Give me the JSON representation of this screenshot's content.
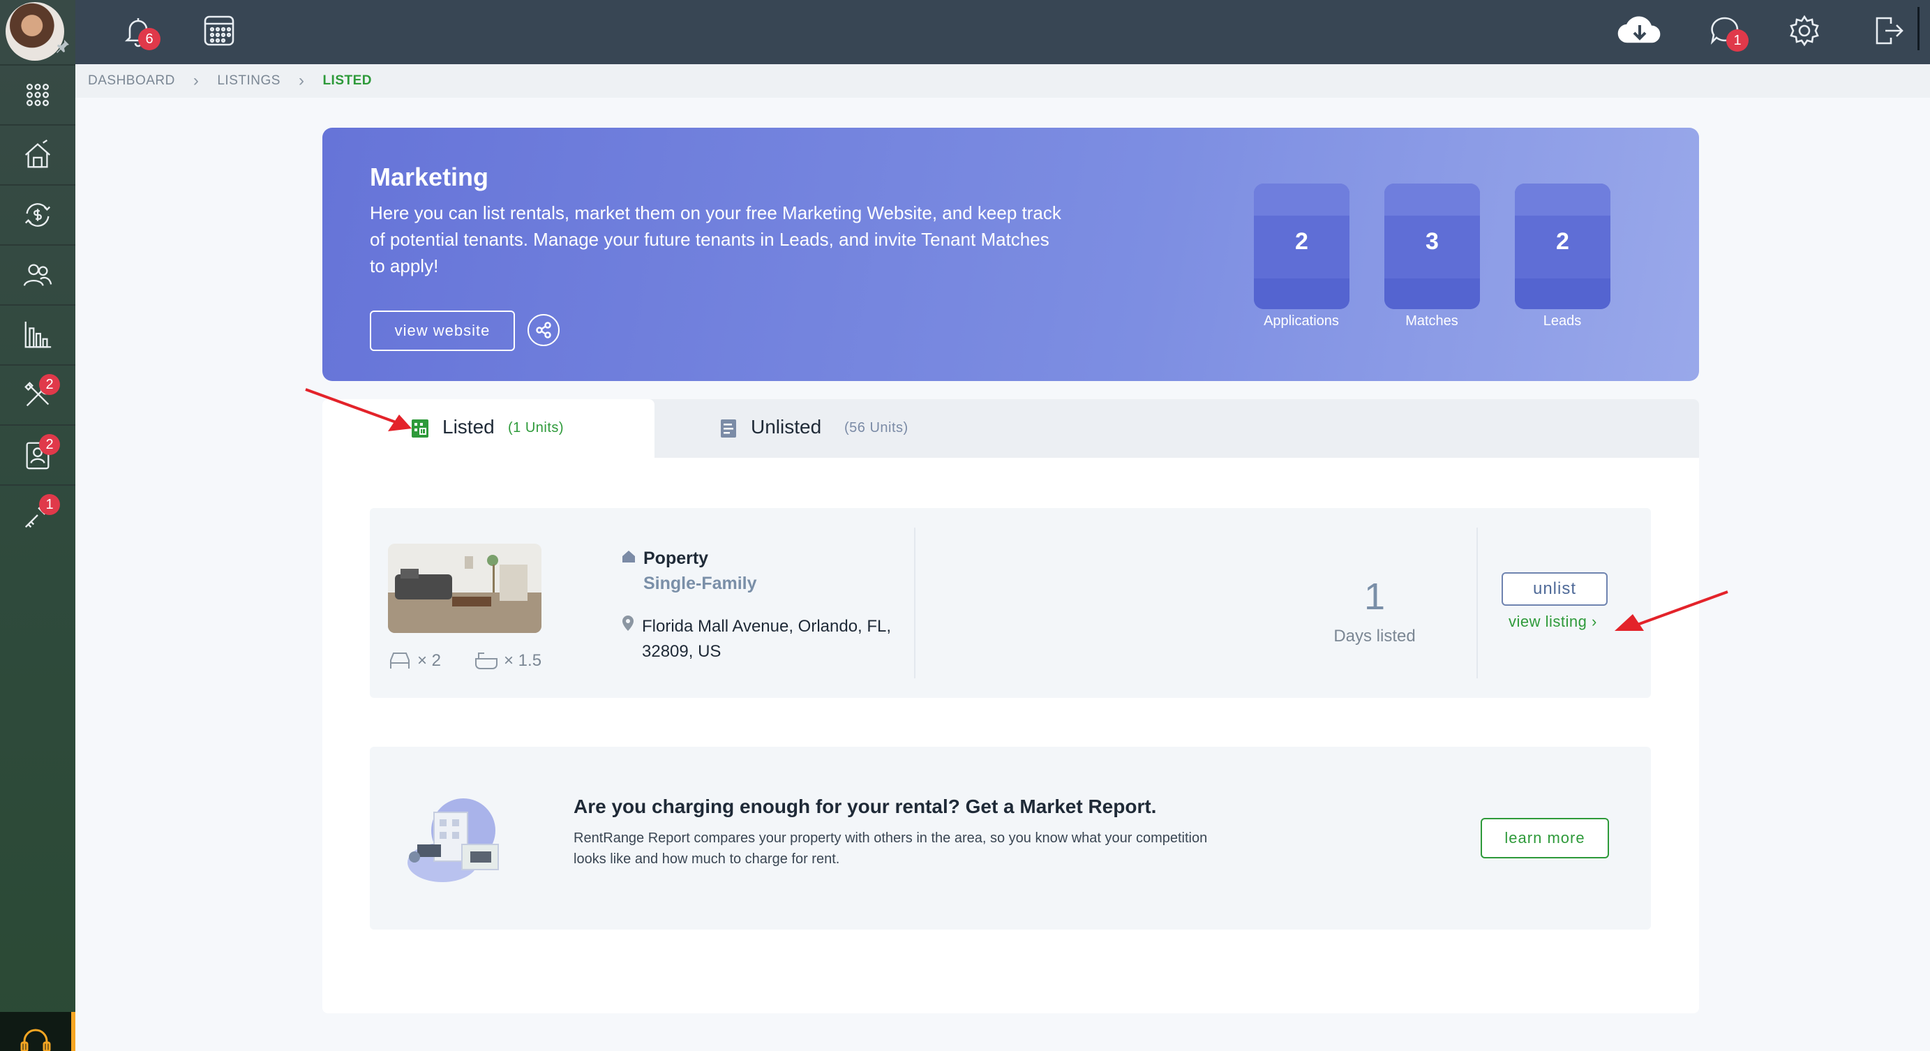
{
  "sidebar": {
    "badges": {
      "tools": "2",
      "contacts": "2",
      "keys": "1"
    }
  },
  "topbar": {
    "notifications_count": "6",
    "messages_count": "1"
  },
  "breadcrumb": {
    "items": [
      "DASHBOARD",
      "LISTINGS",
      "LISTED"
    ]
  },
  "banner": {
    "title": "Marketing",
    "text": "Here you can list rentals, market them on your free Marketing Website, and keep track of potential tenants. Manage your future tenants in Leads, and invite Tenant Matches to apply!",
    "view_website_label": "view website",
    "stats": [
      {
        "value": "2",
        "label": "Applications"
      },
      {
        "value": "3",
        "label": "Matches"
      },
      {
        "value": "2",
        "label": "Leads"
      }
    ]
  },
  "tabs": [
    {
      "label": "Listed",
      "count": "(1 Units)"
    },
    {
      "label": "Unlisted",
      "count": "(56 Units)"
    }
  ],
  "listing": {
    "title": "Poperty",
    "type": "Single-Family",
    "address": "Florida Mall Avenue, Orlando, FL, 32809, US",
    "beds": "× 2",
    "baths": "× 1.5",
    "days_value": "1",
    "days_label": "Days listed",
    "unlist_label": "unlist",
    "view_listing_label": "view listing ›"
  },
  "report": {
    "title": "Are you charging enough for your rental? Get a Market Report.",
    "text": "RentRange Report compares your property with others in the area, so you know what your competition looks like and how much to charge for rent.",
    "button_label": "learn more"
  },
  "colors": {
    "accent_green": "#2e9a3a",
    "banner_blue": "#6674d8",
    "badge_red": "#e0394a",
    "annotation_red": "#e3232a"
  }
}
